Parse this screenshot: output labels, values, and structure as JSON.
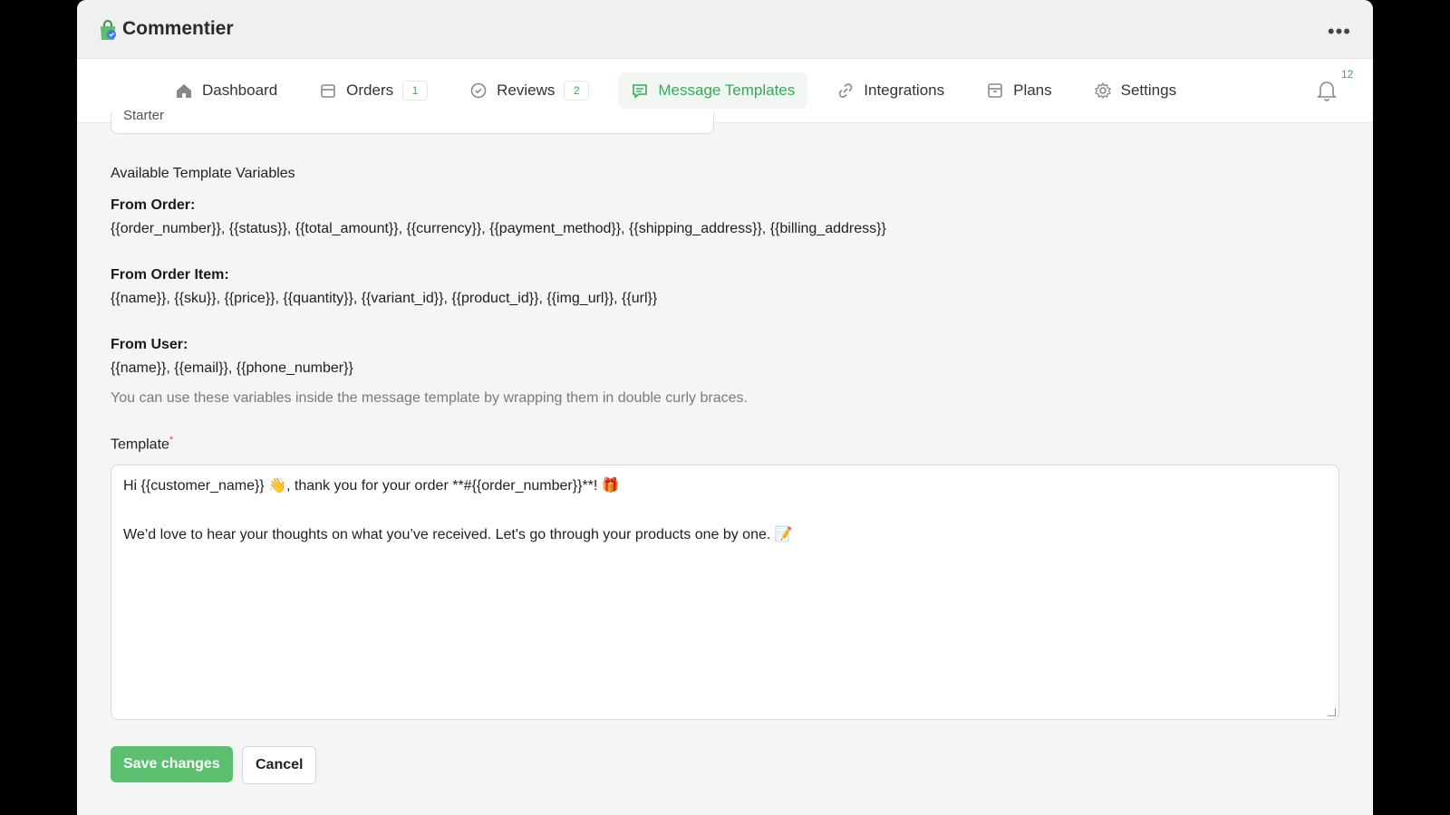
{
  "app": {
    "title": "Commentier"
  },
  "nav": {
    "items": [
      {
        "label": "Dashboard",
        "icon": "home-icon"
      },
      {
        "label": "Orders",
        "icon": "archive-icon",
        "badge": "1"
      },
      {
        "label": "Reviews",
        "icon": "check-circle-icon",
        "badge": "2"
      },
      {
        "label": "Message Templates",
        "icon": "message-icon",
        "active": true
      },
      {
        "label": "Integrations",
        "icon": "link-icon"
      },
      {
        "label": "Plans",
        "icon": "box-icon"
      },
      {
        "label": "Settings",
        "icon": "gear-icon"
      }
    ],
    "notifications_count": "12"
  },
  "form": {
    "previous_field_value": "Starter",
    "variables_title": "Available Template Variables",
    "groups": [
      {
        "heading": "From Order:",
        "vars": "{{order_number}}, {{status}}, {{total_amount}}, {{currency}}, {{payment_method}}, {{shipping_address}}, {{billing_address}}"
      },
      {
        "heading": "From Order Item:",
        "vars": "{{name}}, {{sku}}, {{price}}, {{quantity}}, {{variant_id}}, {{product_id}}, {{img_url}}, {{url}}"
      },
      {
        "heading": "From User:",
        "vars": "{{name}}, {{email}}, {{phone_number}}"
      }
    ],
    "hint": "You can use these variables inside the message template by wrapping them in double curly braces.",
    "template_label": "Template",
    "required_mark": "*",
    "template_lines": [
      "Hi {{customer_name}} 👋, thank you for your order **#{{order_number}}**! 🎁",
      "We’d love to hear your thoughts on what you’ve received. Let's go through your products one by one. 📝"
    ],
    "save_label": "Save changes",
    "cancel_label": "Cancel"
  },
  "colors": {
    "accent": "#5cbf6f",
    "accent_text": "#3aa85a"
  }
}
